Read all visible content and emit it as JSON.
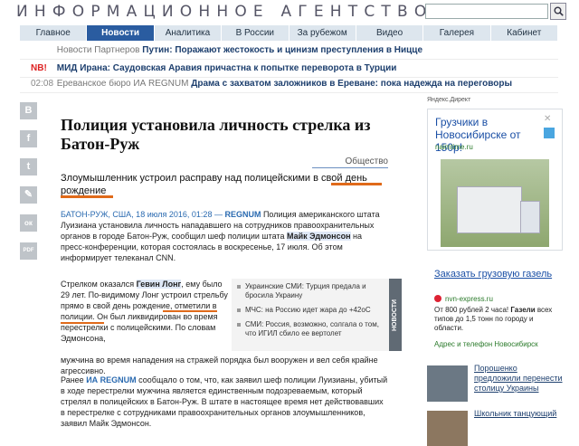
{
  "header": {
    "agency_title": "ИНФОРМАЦИОННОЕ АГЕНТСТВО",
    "search_placeholder": ""
  },
  "nav": {
    "items": [
      {
        "label": "Главное",
        "active": false
      },
      {
        "label": "Новости",
        "active": true
      },
      {
        "label": "Аналитика",
        "active": false
      },
      {
        "label": "В России",
        "active": false
      },
      {
        "label": "За рубежом",
        "active": false
      },
      {
        "label": "Видео",
        "active": false
      },
      {
        "label": "Галерея",
        "active": false
      },
      {
        "label": "Кабинет",
        "active": false
      }
    ]
  },
  "tickers": [
    {
      "lead": "",
      "source": "Новости Партнеров",
      "headline": "Путин: Поражают жестокость и цинизм преступления в Ницце"
    },
    {
      "lead": "NB!",
      "source": "",
      "headline": "МИД Ирана: Саудовская Аравия причастна к попытке переворота в Турции"
    },
    {
      "lead": "02:08",
      "source": "Ереванское бюро ИА REGNUM",
      "headline": "Драма с захватом заложников в Ереване: пока надежда на переговоры"
    }
  ],
  "share_icons": [
    "vk-icon",
    "facebook-icon",
    "twitter-icon",
    "livejournal-icon",
    "odnoklassniki-icon",
    "pdf-icon"
  ],
  "share_glyphs": [
    "B",
    "f",
    "t",
    "✎",
    "ок",
    "PDF"
  ],
  "article": {
    "title": "Полиция установила личность стрелка из Батон-Руж",
    "rubric": "Общество",
    "lead_a": "Злоумышленник устроил расправу над полицейскими ",
    "lead_b": "в свой день рождение",
    "dateline": "БАТОН-РУЖ, США, 18 июля 2016, 01:28 — ",
    "dateline_agency": "REGNUM",
    "p1_a": "  Полиция американского штата Луизиана установила личность нападавшего на сотрудников правоохранительных органов в городе Батон-Руж, сообщил шеф полиции штата ",
    "p1_name": "Майк Эдмонсон",
    "p1_b": " на пресс-конференции, которая состоялась в воскресенье, 17 июля. Об этом информирует телеканал CNN.",
    "p2_a": "Стрелком оказался ",
    "p2_name": "Гевин Лонг",
    "p2_b": ", ему было 29 лет. По-видимому Лонг устроил стрельбу прямо ",
    "p2_c": "в свой день рождение,",
    "p2_d": " отметили в полиции. Он был ликвидирован во время перестрелки с полицейскими. По словам Эдмонсона,",
    "p2_e": "мужчина во время нападения на стражей порядка был вооружен и вел себя крайне агрессивно.",
    "p3_a": "Ранее ",
    "p3_agency": "ИА REGNUM",
    "p3_b": " сообщало о том, что, как заявил шеф полиции Луизианы, убитый в ходе перестрелки мужчина является единственным подозреваемым, который стрелял в полицейских в Батон-Руж. В штате в настоящее время нет действовавших в перестрелке с сотрудниками правоохранительных органов злоумышленников, заявил Майк Эдмонсон."
  },
  "partners": {
    "vertical_label": "НОВОСТИ ПАРТНЕРОВ",
    "items": [
      "Украинские СМИ: Турция предала и бросила Украину",
      "МЧС: на Россию идет жара до +42оС",
      "СМИ: Россия, возможно, солгала о том, что ИГИЛ сбило ее вертолет"
    ]
  },
  "ads": {
    "label": "Яндекс.Директ",
    "ad1": {
      "title": "Грузчики в Новосибирске от 150р!",
      "domain": "naimtime.ru"
    },
    "ad2": {
      "title": "Заказать грузовую газель",
      "domain": "nvn-express.ru",
      "text_a": "От 800 рублей 2 часа! ",
      "text_bold": "Газели",
      "text_b": " всех типов до 1,5 тонн по городу и области.",
      "footer": "Адрес и телефон   Новосибирск"
    }
  },
  "side_news": [
    {
      "text": "Порошенко предложили перенести столицу Украины"
    },
    {
      "text": "Школьник танцующий"
    }
  ]
}
